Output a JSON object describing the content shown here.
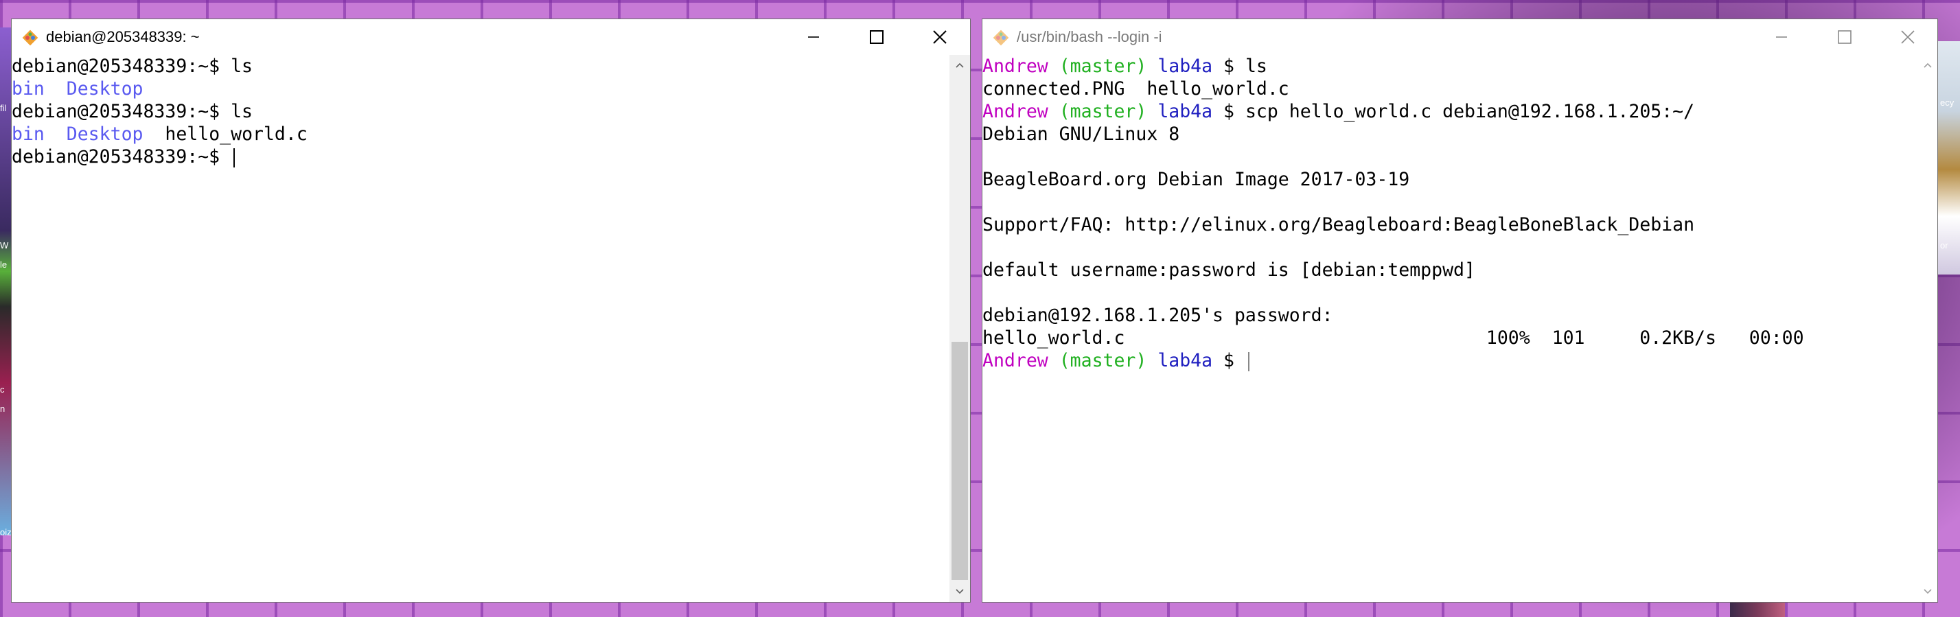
{
  "left_window": {
    "title": "debian@205348339: ~",
    "icon": "git-bash-icon",
    "lines": [
      [
        {
          "t": "debian@205348339:~$ ls",
          "c": ""
        }
      ],
      [
        {
          "t": "bin",
          "c": "c-dir"
        },
        {
          "t": "  ",
          "c": ""
        },
        {
          "t": "Desktop",
          "c": "c-dir"
        }
      ],
      [
        {
          "t": "debian@205348339:~$ ls",
          "c": ""
        }
      ],
      [
        {
          "t": "bin",
          "c": "c-dir"
        },
        {
          "t": "  ",
          "c": ""
        },
        {
          "t": "Desktop",
          "c": "c-dir"
        },
        {
          "t": "  hello_world.c",
          "c": ""
        }
      ],
      [
        {
          "t": "debian@205348339:~$ ",
          "c": ""
        }
      ]
    ],
    "controls": [
      "minimize-icon",
      "maximize-icon",
      "close-icon"
    ]
  },
  "right_window": {
    "title": "/usr/bin/bash --login -i",
    "icon": "git-bash-icon",
    "lines": [
      [
        {
          "t": "Andrew",
          "c": "c-user"
        },
        {
          "t": " ",
          "c": ""
        },
        {
          "t": "(master)",
          "c": "c-branch"
        },
        {
          "t": " ",
          "c": ""
        },
        {
          "t": "lab4a",
          "c": "c-path"
        },
        {
          "t": " $ ls",
          "c": ""
        }
      ],
      [
        {
          "t": "connected.PNG  hello_world.c",
          "c": ""
        }
      ],
      [
        {
          "t": "Andrew",
          "c": "c-user"
        },
        {
          "t": " ",
          "c": ""
        },
        {
          "t": "(master)",
          "c": "c-branch"
        },
        {
          "t": " ",
          "c": ""
        },
        {
          "t": "lab4a",
          "c": "c-path"
        },
        {
          "t": " $ scp hello_world.c debian@192.168.1.205:~/",
          "c": ""
        }
      ],
      [
        {
          "t": "Debian GNU/Linux 8",
          "c": ""
        }
      ],
      [
        {
          "t": "",
          "c": ""
        }
      ],
      [
        {
          "t": "BeagleBoard.org Debian Image 2017-03-19",
          "c": ""
        }
      ],
      [
        {
          "t": "",
          "c": ""
        }
      ],
      [
        {
          "t": "Support/FAQ: http://elinux.org/Beagleboard:BeagleBoneBlack_Debian",
          "c": ""
        }
      ],
      [
        {
          "t": "",
          "c": ""
        }
      ],
      [
        {
          "t": "default username:password is [debian:temppwd]",
          "c": ""
        }
      ],
      [
        {
          "t": "",
          "c": ""
        }
      ],
      [
        {
          "t": "debian@192.168.1.205's password:",
          "c": ""
        }
      ],
      [
        {
          "t": "hello_world.c                                 100%  101     0.2KB/s   00:00",
          "c": ""
        }
      ],
      [
        {
          "t": "Andrew",
          "c": "c-user"
        },
        {
          "t": " ",
          "c": ""
        },
        {
          "t": "(master)",
          "c": "c-branch"
        },
        {
          "t": " ",
          "c": ""
        },
        {
          "t": "lab4a",
          "c": "c-path"
        },
        {
          "t": " $ ",
          "c": ""
        }
      ]
    ],
    "controls": [
      "minimize-icon",
      "maximize-icon",
      "close-icon"
    ]
  },
  "desktop": {
    "left_icon_labels": [
      "fil",
      "W",
      "le",
      "c",
      "n",
      "oiz"
    ],
    "right_icon_labels": [
      "ecy",
      "or"
    ]
  },
  "colors": {
    "dir": "#5a5af0",
    "user": "#c000c0",
    "branch": "#20b020",
    "path": "#2020c0",
    "desktop": "#c77ad6"
  }
}
